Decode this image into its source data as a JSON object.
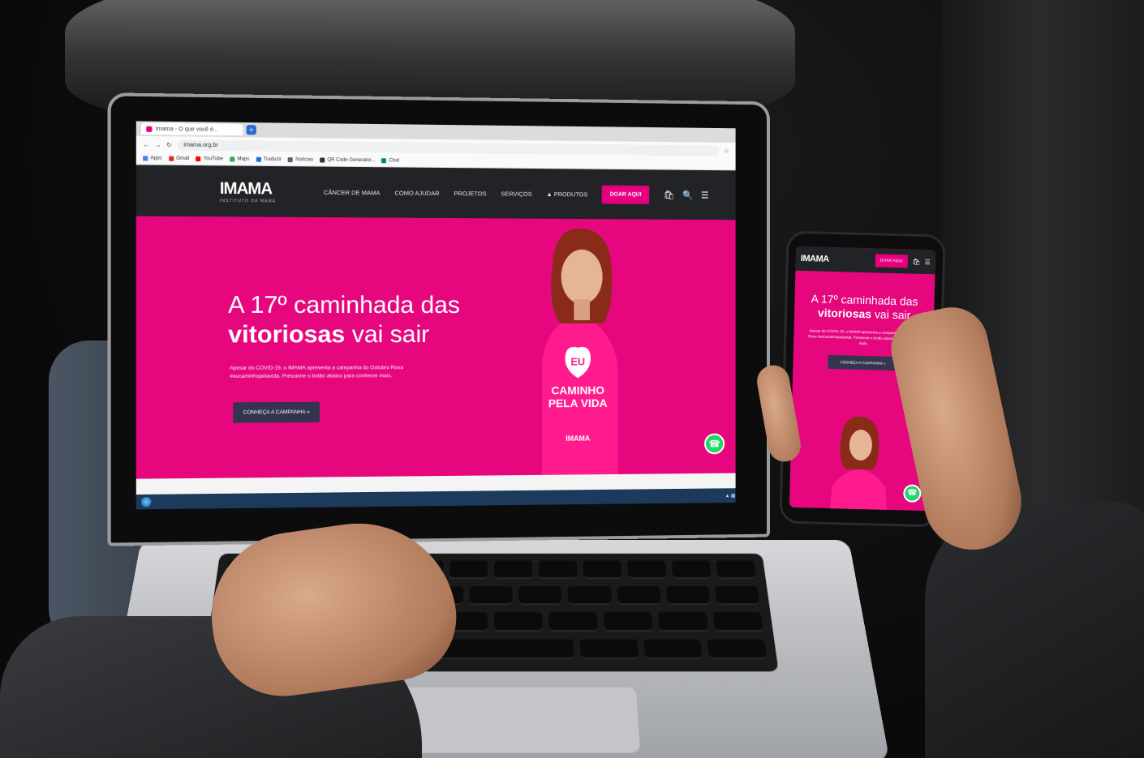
{
  "browser": {
    "tab_title": "Imama - O que você é...",
    "new_tab": "+",
    "url": "imama.org.br",
    "bookmarks": [
      "Apps",
      "Gmail",
      "YouTube",
      "Maps",
      "Traduzir",
      "Notícias",
      "QR Code Generator...",
      "Chat"
    ]
  },
  "site": {
    "logo": "IMAMA",
    "logo_tagline": "INSTITUTO DA MAMA",
    "nav": [
      "CÂNCER DE MAMA",
      "COMO AJUDAR",
      "PROJETOS",
      "SERVIÇOS",
      "PRODUTOS"
    ],
    "donate_button": "DOAR AQUI",
    "hero": {
      "title_line1": "A 17º caminhada das",
      "title_bold": "vitoriosas",
      "title_rest": " vai sair",
      "text": "Apesar do COVID-19, o IMAMA apresenta a campanha do Outubro Rosa #eucaminhopelavida. Pressione o botão abaixo para conhecer mais.",
      "cta": "CONHEÇA A CAMPANHA »"
    },
    "shirt": {
      "heart_text": "EU",
      "line1": "CAMINHO",
      "line2": "PELA VIDA",
      "brand": "IMAMA"
    },
    "whatsapp_icon": "whatsapp-icon"
  },
  "phone": {
    "logo": "IMAMA",
    "donate_button": "DOAR AQUI",
    "title_line1": "A 17º caminhada das",
    "title_bold": "vitoriosas",
    "title_rest": " vai sair",
    "text": "Apesar do COVID-19, o IMAMA apresenta a campanha do Outubro Rosa #eucaminhopelavida. Pressione o botão abaixo para conhecer mais.",
    "cta": "CONHEÇA A CAMPANHA »"
  },
  "colors": {
    "brand_pink": "#e6077f",
    "nav_dark": "#222326",
    "cta_navy": "#34344f",
    "whatsapp_green": "#25d366"
  }
}
